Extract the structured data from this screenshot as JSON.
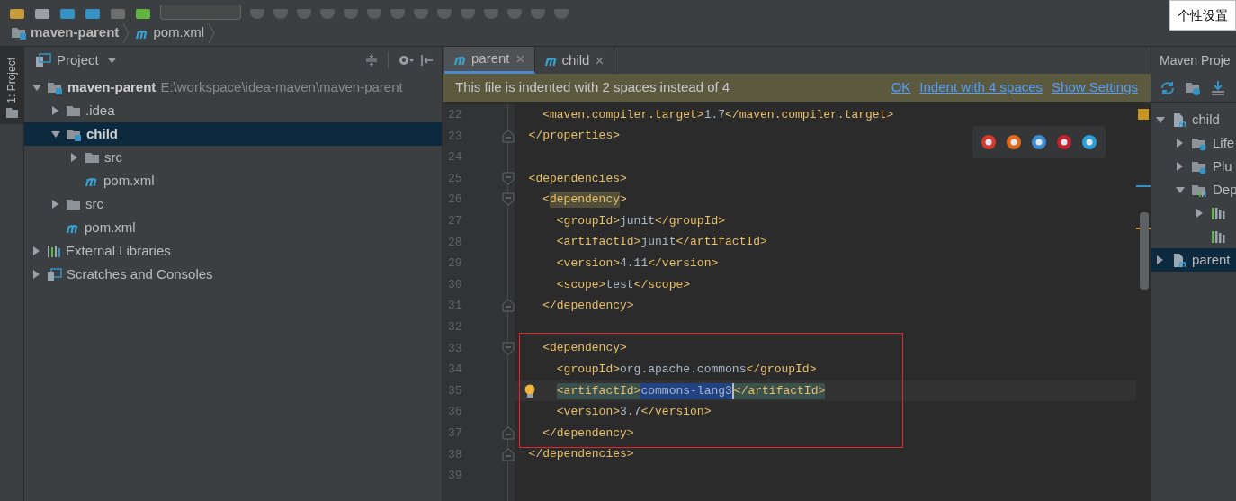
{
  "toolbar": {
    "tooltip": "个性设置"
  },
  "breadcrumb": [
    {
      "label": "maven-parent",
      "kind": "module"
    },
    {
      "label": "pom.xml",
      "kind": "maven"
    }
  ],
  "left_strip": {
    "tab": "1: Project"
  },
  "project_panel": {
    "title": "Project",
    "tree": [
      {
        "label": "maven-parent",
        "kind": "module",
        "path": "E:\\workspace\\idea-maven\\maven-parent",
        "expanded": true,
        "selected": false,
        "children": [
          {
            "label": ".idea",
            "kind": "folder",
            "expanded": false,
            "selected": false
          },
          {
            "label": "child",
            "kind": "module",
            "expanded": true,
            "selected": true,
            "children": [
              {
                "label": "src",
                "kind": "folder",
                "expanded": false,
                "selected": false
              },
              {
                "label": "pom.xml",
                "kind": "maven",
                "selected": false
              }
            ]
          },
          {
            "label": "src",
            "kind": "folder",
            "expanded": false,
            "selected": false
          },
          {
            "label": "pom.xml",
            "kind": "maven",
            "selected": false
          }
        ]
      },
      {
        "label": "External Libraries",
        "kind": "libraries",
        "expanded": false,
        "selected": false
      },
      {
        "label": "Scratches and Consoles",
        "kind": "scratches",
        "expanded": false,
        "selected": false
      }
    ]
  },
  "editor": {
    "tabs": [
      {
        "label": "parent",
        "selected": true
      },
      {
        "label": "child",
        "selected": false
      }
    ],
    "notification": {
      "message": "This file is indented with 2 spaces instead of 4",
      "actions": [
        "OK",
        "Indent with 4 spaces",
        "Show Settings"
      ]
    },
    "lines": [
      {
        "kind": "plain",
        "number": "22",
        "segments": [
          {
            "kind": "tag",
            "text": "    <maven.compiler.target>"
          },
          {
            "kind": "value",
            "text": "1.7"
          },
          {
            "kind": "tag",
            "text": "</maven.compiler.target>"
          }
        ]
      },
      {
        "kind": "fold-end",
        "number": "23",
        "segments": [
          {
            "kind": "tag",
            "text": "  </properties>"
          }
        ]
      },
      {
        "kind": "plain",
        "number": "24"
      },
      {
        "kind": "fold-start",
        "number": "25",
        "segments": [
          {
            "kind": "tag",
            "text": "  <dependencies>"
          }
        ]
      },
      {
        "kind": "fold-start",
        "number": "26",
        "segments": [
          {
            "kind": "tag",
            "text": "    <"
          },
          {
            "kind": "word-match",
            "text": "dependency"
          },
          {
            "kind": "tag",
            "text": ">"
          }
        ]
      },
      {
        "kind": "plain",
        "number": "27",
        "segments": [
          {
            "kind": "tag",
            "text": "      <groupId>"
          },
          {
            "kind": "value",
            "text": "junit"
          },
          {
            "kind": "tag",
            "text": "</groupId>"
          }
        ]
      },
      {
        "kind": "plain",
        "number": "28",
        "segments": [
          {
            "kind": "tag",
            "text": "      <artifactId>"
          },
          {
            "kind": "value",
            "text": "junit"
          },
          {
            "kind": "tag",
            "text": "</artifactId>"
          }
        ]
      },
      {
        "kind": "plain",
        "number": "29",
        "segments": [
          {
            "kind": "tag",
            "text": "      <version>"
          },
          {
            "kind": "value",
            "text": "4.11"
          },
          {
            "kind": "tag",
            "text": "</version>"
          }
        ]
      },
      {
        "kind": "plain",
        "number": "30",
        "segments": [
          {
            "kind": "tag",
            "text": "      <scope>"
          },
          {
            "kind": "value",
            "text": "test"
          },
          {
            "kind": "tag",
            "text": "</scope>"
          }
        ]
      },
      {
        "kind": "fold-end",
        "number": "31",
        "segments": [
          {
            "kind": "tag",
            "text": "    </dependency>"
          }
        ]
      },
      {
        "kind": "plain",
        "number": "32"
      },
      {
        "kind": "framed",
        "lines": [
          {
            "kind": "fold-start",
            "number": "33",
            "segments": [
              {
                "kind": "tag",
                "text": "    <dependency>"
              }
            ]
          },
          {
            "kind": "plain",
            "number": "34",
            "segments": [
              {
                "kind": "tag",
                "text": "      <groupId>"
              },
              {
                "kind": "value",
                "text": "org.apache.commons"
              },
              {
                "kind": "tag",
                "text": "</groupId>"
              }
            ]
          },
          {
            "kind": "plain",
            "number": "35",
            "current": true,
            "bulb": true,
            "segments": [
              {
                "kind": "tag-match",
                "text": "      <artifactId>"
              },
              {
                "kind": "selection",
                "text": "commons-lang3"
              },
              {
                "kind": "tag-match",
                "text": "</artifactId>"
              }
            ]
          },
          {
            "kind": "plain",
            "number": "36",
            "segments": [
              {
                "kind": "tag",
                "text": "      <version>"
              },
              {
                "kind": "value",
                "text": "3.7"
              },
              {
                "kind": "tag",
                "text": "</version>"
              }
            ]
          },
          {
            "kind": "fold-end",
            "number": "37",
            "segments": [
              {
                "kind": "tag",
                "text": "    </dependency>"
              }
            ]
          }
        ]
      },
      {
        "kind": "fold-end",
        "number": "38",
        "segments": [
          {
            "kind": "tag",
            "text": "  </dependencies>"
          }
        ]
      },
      {
        "kind": "plain",
        "number": "39"
      }
    ]
  },
  "maven_panel": {
    "title": "Maven Proje",
    "tree": [
      {
        "label": "child",
        "kind": "project",
        "expanded": true,
        "selected": false,
        "children": [
          {
            "label": "Life",
            "kind": "lifecycle",
            "expanded": false,
            "selected": false
          },
          {
            "label": "Plu",
            "kind": "plugins",
            "expanded": false,
            "selected": false
          },
          {
            "label": "Dep",
            "kind": "dependencies",
            "expanded": true,
            "selected": false,
            "children": [
              {
                "kind": "library",
                "expanded": false,
                "selected": false
              },
              {
                "kind": "library",
                "selected": false
              }
            ]
          }
        ]
      },
      {
        "label": "parent",
        "kind": "project",
        "expanded": false,
        "selected": true
      }
    ]
  }
}
